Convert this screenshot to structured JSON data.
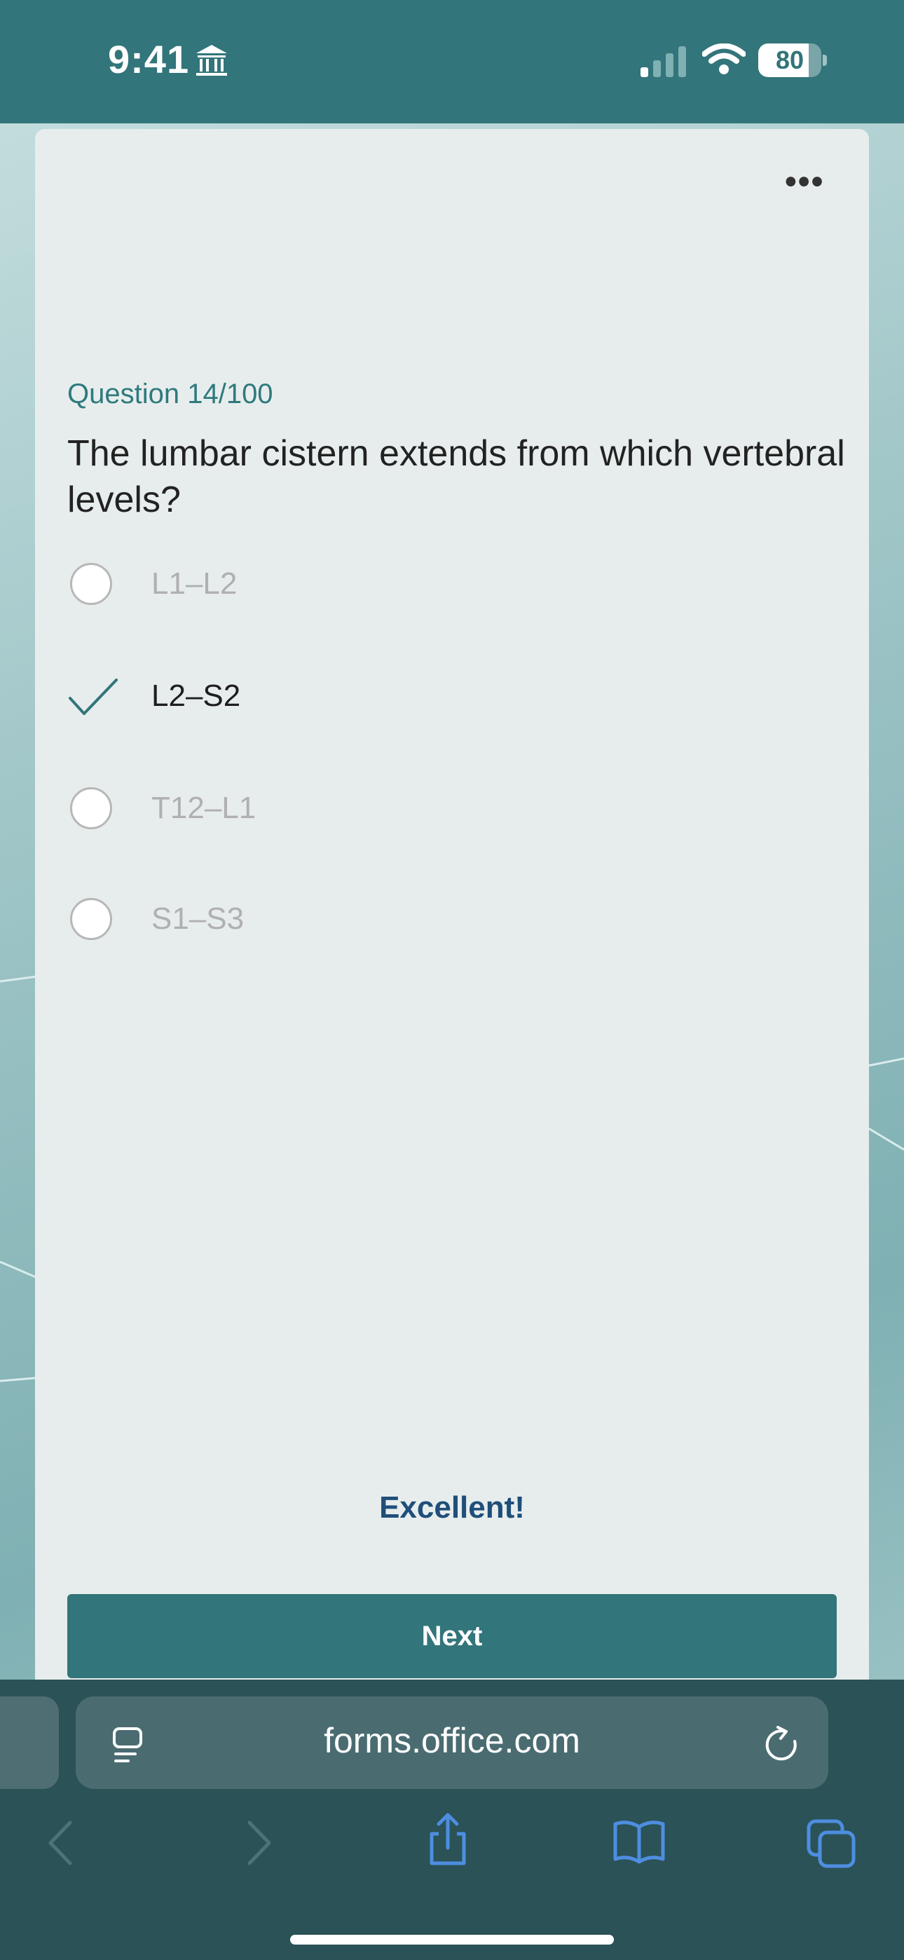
{
  "status_bar": {
    "time": "9:41",
    "battery_level": 80,
    "battery_label": "80"
  },
  "question": {
    "number_label": "Question 14/100",
    "text": "The lumbar cistern extends from which vertebral levels?",
    "options": [
      {
        "label": "L1–L2",
        "selected": false
      },
      {
        "label": "L2–S2",
        "selected": true
      },
      {
        "label": "T12–L1",
        "selected": false
      },
      {
        "label": "S1–S3",
        "selected": false
      }
    ]
  },
  "feedback": "Excellent!",
  "next_label": "Next",
  "browser": {
    "url": "forms.office.com"
  },
  "colors": {
    "brand": "#32757a",
    "feedback": "#1f4e7a",
    "browser_icon": "#4e8ee0"
  },
  "icons": {
    "more": "more-icon",
    "check": "check-icon",
    "page_menu": "page-menu-icon",
    "reload": "reload-icon",
    "back": "chevron-left-icon",
    "forward": "chevron-right-icon",
    "share": "share-icon",
    "bookmarks": "book-icon",
    "tabs": "tabs-icon"
  }
}
